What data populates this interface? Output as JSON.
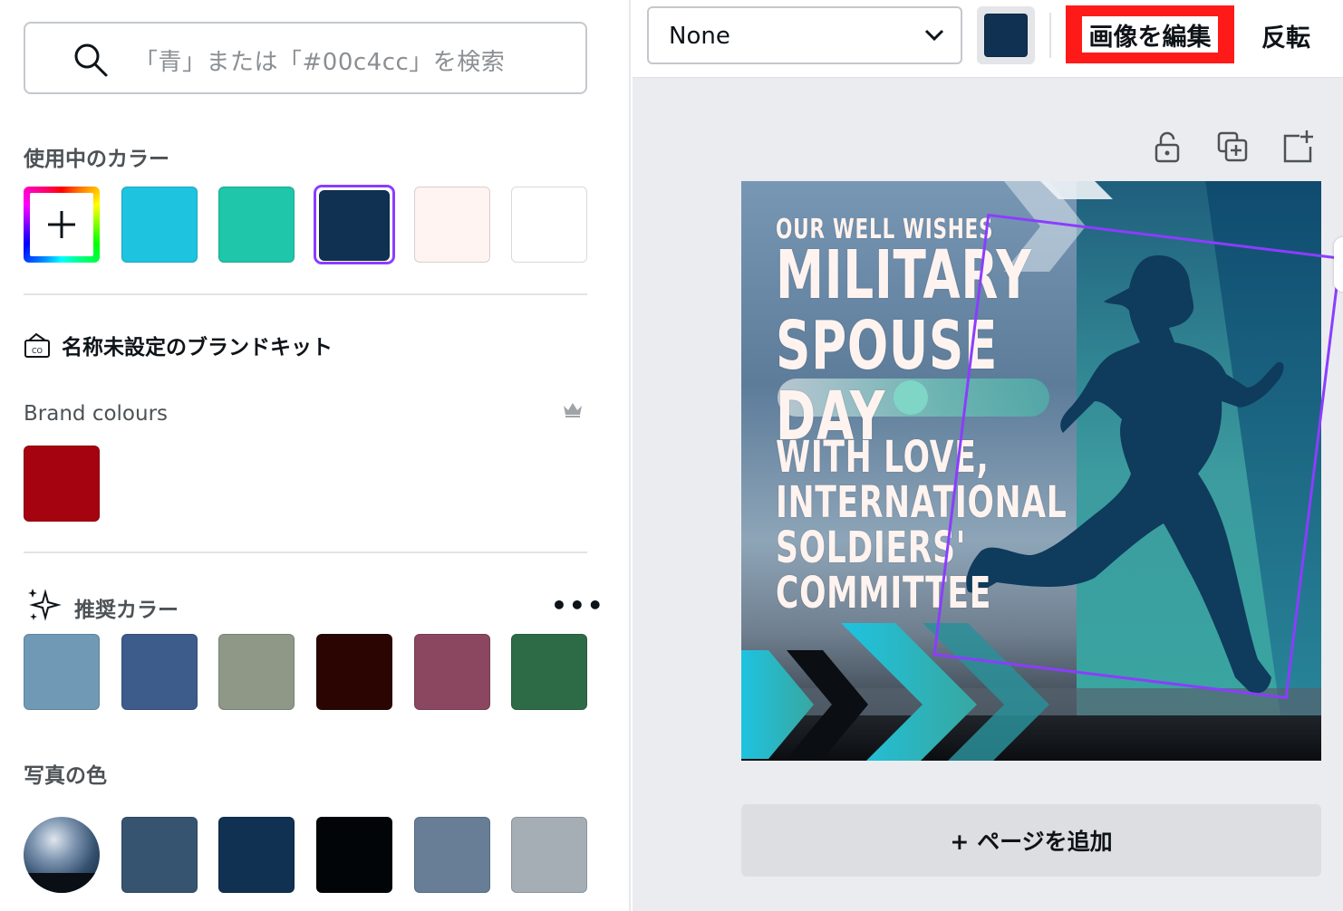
{
  "search": {
    "placeholder": "「青」または「#00c4cc」を検索"
  },
  "in_use": {
    "title": "使用中のカラー",
    "add_icon": "plus-icon",
    "colors": [
      "#1ec3e0",
      "#1fc6a9",
      "#103152",
      "#fff4f2",
      "#ffffff"
    ],
    "selected_color": "#103152"
  },
  "brand_kit": {
    "icon": "brand-kit-icon",
    "title": "名称未設定のブランドキット"
  },
  "brand_colours": {
    "title": "Brand colours",
    "icon": "crown-icon",
    "colors": [
      "#a50310"
    ]
  },
  "suggested": {
    "title": "推奨カラー",
    "icon": "sparkle-icon",
    "more_label": "•••",
    "colors": [
      "#7099b5",
      "#3d5b8b",
      "#8f9887",
      "#2a0502",
      "#8b4660",
      "#2c6b45"
    ]
  },
  "photo_colors": {
    "title": "写真の色",
    "colors": [
      "#365470",
      "#113152",
      "#020508",
      "#677e96",
      "#a5adb5"
    ]
  },
  "toolbar": {
    "select_value": "None",
    "color_chip": "#103152",
    "edit_image_label": "画像を編集",
    "flip_label": "反転"
  },
  "canvas_tools": [
    "lock-icon",
    "duplicate-icon",
    "add-page-icon"
  ],
  "artboard": {
    "line1": "OUR WELL WISHES",
    "line2": "MILITARY",
    "line3": "SPOUSE",
    "line4": "DAY",
    "line5": "WITH LOVE,",
    "line6": "INTERNATIONAL",
    "line7": "SOLDIERS'",
    "line8": "COMMITTEE"
  },
  "add_page_label": "+ ページを追加"
}
